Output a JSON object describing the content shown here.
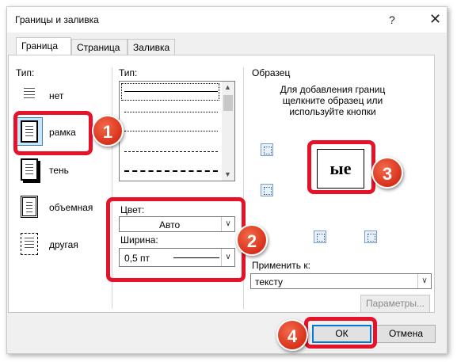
{
  "dialog": {
    "title": "Границы и заливка",
    "help": "?",
    "close": "✕"
  },
  "tabs": [
    {
      "label": "Граница",
      "active": true
    },
    {
      "label": "Страница",
      "active": false
    },
    {
      "label": "Заливка",
      "active": false
    }
  ],
  "setting": {
    "label": "Тип:",
    "items": [
      {
        "label": "нет",
        "icon": "border-none-icon",
        "selected": false
      },
      {
        "label": "рамка",
        "icon": "border-box-icon",
        "selected": true
      },
      {
        "label": "тень",
        "icon": "border-shadow-icon",
        "selected": false
      },
      {
        "label": "объемная",
        "icon": "border-3d-icon",
        "selected": false
      },
      {
        "label": "другая",
        "icon": "border-custom-icon",
        "selected": false
      }
    ]
  },
  "style": {
    "label": "Тип:",
    "options": [
      "solid",
      "dotted",
      "dotted-sparse",
      "dashed",
      "dashed-long"
    ]
  },
  "color": {
    "label": "Цвет:",
    "value": "Авто"
  },
  "width": {
    "label": "Ширина:",
    "value": "0,5 пт"
  },
  "preview": {
    "label": "Образец",
    "hint": "Для добавления границ щелкните образец или используйте кнопки",
    "sample_text": "ые"
  },
  "apply_to": {
    "label": "Применить к:",
    "value": "тексту"
  },
  "buttons": {
    "options": "Параметры...",
    "ok": "ОК",
    "cancel": "Отмена"
  },
  "annotations": [
    "1",
    "2",
    "3",
    "4"
  ],
  "colors": {
    "accent": "#0078d7",
    "callout": "#e5122a",
    "badge": "#d8311a"
  }
}
